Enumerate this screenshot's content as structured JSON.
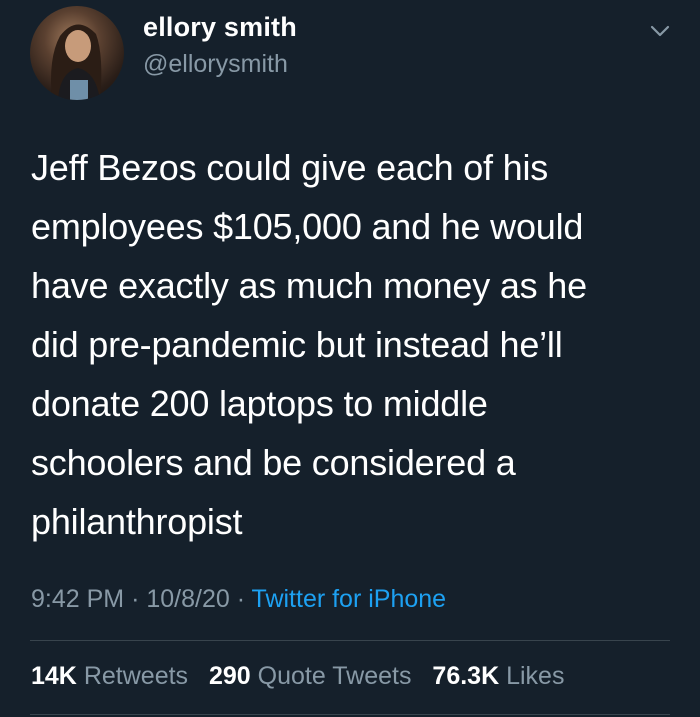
{
  "user": {
    "display_name": "ellory smith",
    "handle": "@ellorysmith"
  },
  "tweet": {
    "text": "Jeff Bezos could give each of his\nemployees $105,000 and he would\nhave exactly as much money as he\ndid pre-pandemic but instead he’ll\ndonate 200 laptops to middle\nschoolers and be considered a\nphilanthropist",
    "time": "9:42 PM",
    "date": "10/8/20",
    "separator": "·",
    "source": "Twitter for iPhone"
  },
  "stats": [
    {
      "count": "14K",
      "label": "Retweets"
    },
    {
      "count": "290",
      "label": "Quote Tweets"
    },
    {
      "count": "76.3K",
      "label": "Likes"
    }
  ],
  "icons": {
    "menu": "chevron-down-icon",
    "avatar": "profile-photo"
  },
  "colors": {
    "background": "#15202b",
    "primary_text": "#ffffff",
    "secondary_text": "#8899a6",
    "link": "#1da1f2",
    "divider": "#38444d"
  }
}
